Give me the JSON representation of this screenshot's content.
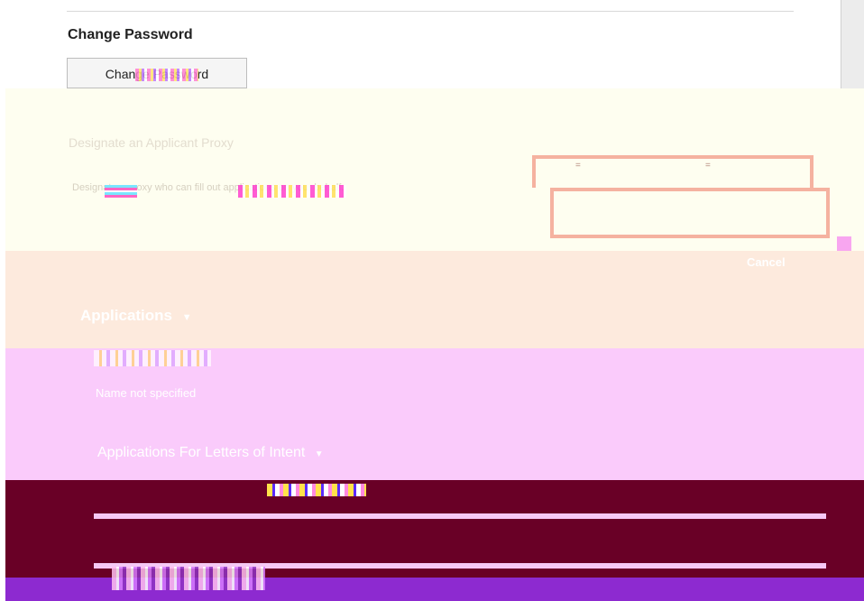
{
  "account": {
    "section_title": "Change Password",
    "change_password_button": "Change Password"
  },
  "designate": {
    "title": "Designate an Applicant Proxy",
    "description": "Designate a proxy who can fill out applications on your behalf."
  },
  "dialog": {
    "cancel_label": "Cancel"
  },
  "applications": {
    "heading": "Applications",
    "name_line": "Name not specified",
    "sub_heading": "Applications For Letters of Intent"
  },
  "icons": {
    "expand": "chevron-down-icon"
  }
}
